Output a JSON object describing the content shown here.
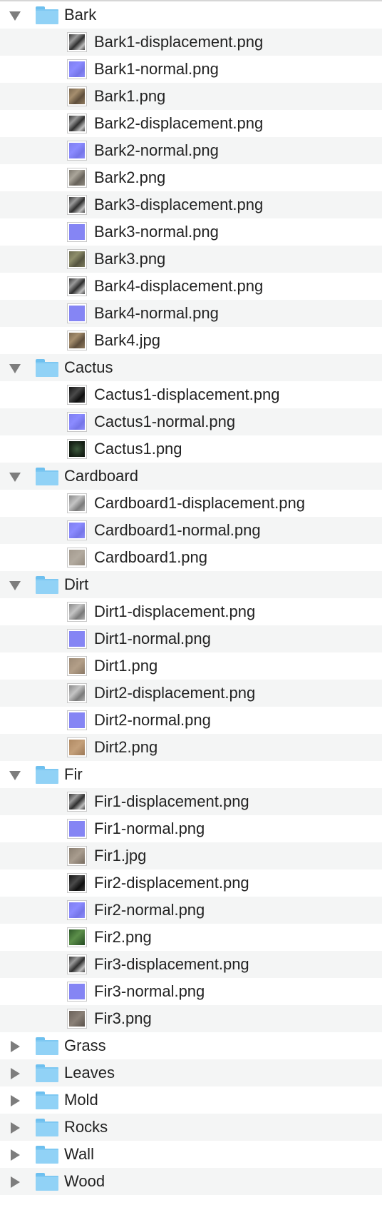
{
  "tree": [
    {
      "type": "folder",
      "label": "Bark",
      "expanded": true
    },
    {
      "type": "file",
      "label": "Bark1-displacement.png",
      "thumb": "t-disp"
    },
    {
      "type": "file",
      "label": "Bark1-normal.png",
      "thumb": "t-normal"
    },
    {
      "type": "file",
      "label": "Bark1.png",
      "thumb": "t-bark"
    },
    {
      "type": "file",
      "label": "Bark2-displacement.png",
      "thumb": "t-disp"
    },
    {
      "type": "file",
      "label": "Bark2-normal.png",
      "thumb": "t-normal"
    },
    {
      "type": "file",
      "label": "Bark2.png",
      "thumb": "t-bark-grey"
    },
    {
      "type": "file",
      "label": "Bark3-displacement.png",
      "thumb": "t-disp"
    },
    {
      "type": "file",
      "label": "Bark3-normal.png",
      "thumb": "t-normal-flat"
    },
    {
      "type": "file",
      "label": "Bark3.png",
      "thumb": "t-bark-green"
    },
    {
      "type": "file",
      "label": "Bark4-displacement.png",
      "thumb": "t-disp"
    },
    {
      "type": "file",
      "label": "Bark4-normal.png",
      "thumb": "t-normal-flat"
    },
    {
      "type": "file",
      "label": "Bark4.jpg",
      "thumb": "t-bark"
    },
    {
      "type": "folder",
      "label": "Cactus",
      "expanded": true
    },
    {
      "type": "file",
      "label": "Cactus1-displacement.png",
      "thumb": "t-disp-dark"
    },
    {
      "type": "file",
      "label": "Cactus1-normal.png",
      "thumb": "t-normal"
    },
    {
      "type": "file",
      "label": "Cactus1.png",
      "thumb": "t-cactus"
    },
    {
      "type": "folder",
      "label": "Cardboard",
      "expanded": true
    },
    {
      "type": "file",
      "label": "Cardboard1-displacement.png",
      "thumb": "t-disp-light"
    },
    {
      "type": "file",
      "label": "Cardboard1-normal.png",
      "thumb": "t-normal"
    },
    {
      "type": "file",
      "label": "Cardboard1.png",
      "thumb": "t-cardboard"
    },
    {
      "type": "folder",
      "label": "Dirt",
      "expanded": true
    },
    {
      "type": "file",
      "label": "Dirt1-displacement.png",
      "thumb": "t-disp-light"
    },
    {
      "type": "file",
      "label": "Dirt1-normal.png",
      "thumb": "t-normal-flat"
    },
    {
      "type": "file",
      "label": "Dirt1.png",
      "thumb": "t-dirt"
    },
    {
      "type": "file",
      "label": "Dirt2-displacement.png",
      "thumb": "t-disp-light"
    },
    {
      "type": "file",
      "label": "Dirt2-normal.png",
      "thumb": "t-normal-flat"
    },
    {
      "type": "file",
      "label": "Dirt2.png",
      "thumb": "t-dirt2"
    },
    {
      "type": "folder",
      "label": "Fir",
      "expanded": true
    },
    {
      "type": "file",
      "label": "Fir1-displacement.png",
      "thumb": "t-disp"
    },
    {
      "type": "file",
      "label": "Fir1-normal.png",
      "thumb": "t-normal-flat"
    },
    {
      "type": "file",
      "label": "Fir1.jpg",
      "thumb": "t-fir1"
    },
    {
      "type": "file",
      "label": "Fir2-displacement.png",
      "thumb": "t-disp-dark"
    },
    {
      "type": "file",
      "label": "Fir2-normal.png",
      "thumb": "t-normal"
    },
    {
      "type": "file",
      "label": "Fir2.png",
      "thumb": "t-fir2"
    },
    {
      "type": "file",
      "label": "Fir3-displacement.png",
      "thumb": "t-disp"
    },
    {
      "type": "file",
      "label": "Fir3-normal.png",
      "thumb": "t-normal-flat"
    },
    {
      "type": "file",
      "label": "Fir3.png",
      "thumb": "t-fir3"
    },
    {
      "type": "folder",
      "label": "Grass",
      "expanded": false
    },
    {
      "type": "folder",
      "label": "Leaves",
      "expanded": false
    },
    {
      "type": "folder",
      "label": "Mold",
      "expanded": false
    },
    {
      "type": "folder",
      "label": "Rocks",
      "expanded": false
    },
    {
      "type": "folder",
      "label": "Wall",
      "expanded": false
    },
    {
      "type": "folder",
      "label": "Wood",
      "expanded": false
    }
  ],
  "icons": {
    "folder_color": "#91d2f6",
    "disclosure_color": "#7d7d7d"
  }
}
